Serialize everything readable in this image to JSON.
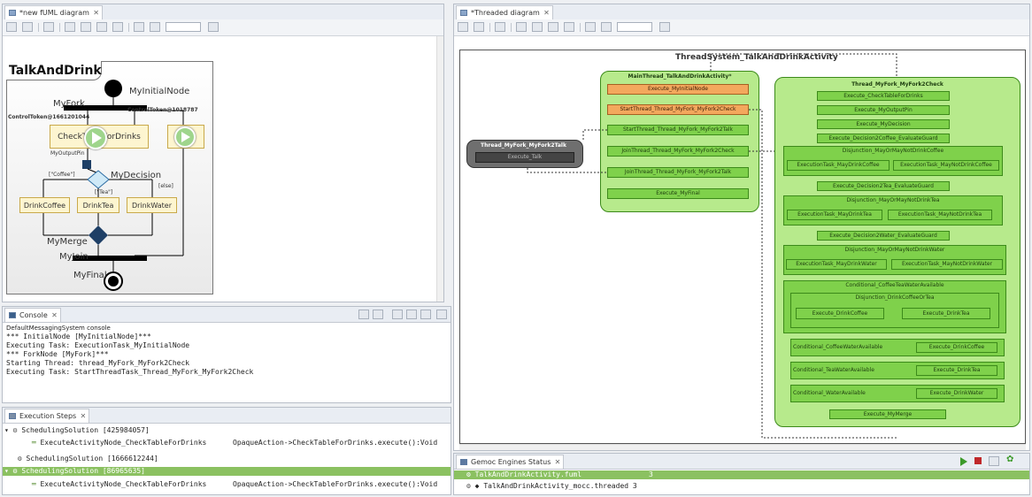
{
  "left_editor": {
    "tab_title": "*new fUML diagram",
    "activity_title": "TalkAndDrink",
    "nodes": {
      "initial": "MyInitialNode",
      "fork": "MyFork",
      "token1": "ControlToken@1661201044",
      "token2": "ControlToken@1018787",
      "check": "CheckTableForDrinks",
      "outpin": "MyOutputPin",
      "decision": "MyDecision",
      "coffee_guard": "[\"Coffee\"]",
      "tea_guard": "[\"Tea\"]",
      "else_guard": "[else]",
      "drink_coffee": "DrinkCoffee",
      "drink_tea": "DrinkTea",
      "drink_water": "DrinkWater",
      "merge": "MyMerge",
      "join": "MyJoin",
      "final": "MyFinal"
    }
  },
  "console": {
    "tab_title": "Console",
    "header": "DefaultMessagingSystem console",
    "lines": [
      "*** InitialNode [MyInitialNode]***",
      "Executing Task: ExecutionTask_MyInitialNode",
      "*** ForkNode [MyFork]***",
      "Starting Thread: thread_MyFork_MyFork2Check",
      "Executing Task: StartThreadTask_Thread_MyFork_MyFork2Check"
    ]
  },
  "execution_steps": {
    "tab_title": "Execution Steps",
    "rows": [
      {
        "label": "SchedulingSolution [425984057]",
        "detail": ""
      },
      {
        "label": "ExecuteActivityNode_CheckTableForDrinks",
        "detail": "OpaqueAction->CheckTableForDrinks.execute():Void"
      },
      {
        "label": "SchedulingSolution [1666612244]",
        "detail": ""
      },
      {
        "label": "SchedulingSolution [86965635]",
        "detail": ""
      },
      {
        "label": "ExecuteActivityNode_CheckTableForDrinks",
        "detail": "OpaqueAction->CheckTableForDrinks.execute():Void"
      }
    ]
  },
  "right_editor": {
    "tab_title": "*Threaded diagram",
    "system_title": "ThreadSystem_TalkAndDrinkActivity",
    "main_thread": {
      "title": "MainThread_TalkAndDrinkActivity*",
      "tasks": [
        "Execute_MyInitialNode",
        "StartThread_Thread_MyFork_MyFork2Check",
        "StartThread_Thread_MyFork_MyFork2Talk",
        "JoinThread_Thread_MyFork_MyFork2Check",
        "JoinThread_Thread_MyFork_MyFork2Talk",
        "Execute_MyFinal"
      ]
    },
    "talk_thread": {
      "title": "Thread_MyFork_MyFork2Talk",
      "task": "Execute_Talk"
    },
    "check_thread": {
      "title": "Thread_MyFork_MyFork2Check",
      "tasks": [
        "Execute_CheckTableForDrinks",
        "Execute_MyOutputPin",
        "Execute_MyDecision",
        "Execute_Decision2Coffee_EvaluateGuard"
      ],
      "disj1": {
        "title": "Disjunction_MayOrMayNotDrinkCoffee",
        "a": "ExecutionTask_MayDrinkCoffee",
        "b": "ExecutionTask_MayNotDrinkCoffee"
      },
      "eval_tea": "Execute_Decision2Tea_EvaluateGuard",
      "disj2": {
        "title": "Disjunction_MayOrMayNotDrinkTea",
        "a": "ExecutionTask_MayDrinkTea",
        "b": "ExecutionTask_MayNotDrinkTea"
      },
      "eval_water": "Execute_Decision2Water_EvaluateGuard",
      "disj3": {
        "title": "Disjunction_MayOrMayNotDrinkWater",
        "a": "ExecutionTask_MayDrinkWater",
        "b": "ExecutionTask_MayNotDrinkWater"
      },
      "conditional": {
        "title": "Conditional_CoffeeTeaWaterAvailable",
        "inner_title": "Disjunction_DrinkCoffeeOrTea",
        "a": "Execute_DrinkCoffee",
        "b": "Execute_DrinkTea"
      },
      "conds": [
        {
          "label": "Conditional_CoffeeWaterAvailable",
          "task": "Execute_DrinkCoffee"
        },
        {
          "label": "Conditional_TeaWaterAvailable",
          "task": "Execute_DrinkTea"
        },
        {
          "label": "Conditional_WaterAvailable",
          "task": "Execute_DrinkWater"
        }
      ],
      "merge": "Execute_MyMerge"
    }
  },
  "engines": {
    "tab_title": "Gemoc Engines Status",
    "rows": [
      {
        "name": "TalkAndDrinkActivity.fuml",
        "count": "3"
      },
      {
        "name": "TalkAndDrinkActivity_mocc.threaded",
        "count": "3"
      }
    ]
  },
  "colors": {
    "green_task": "#7fd14b",
    "green_container": "#b7ea8c",
    "orange_task": "#f3a85d",
    "dark_thread": "#6f6f6f",
    "selected_row": "#8bc161"
  }
}
